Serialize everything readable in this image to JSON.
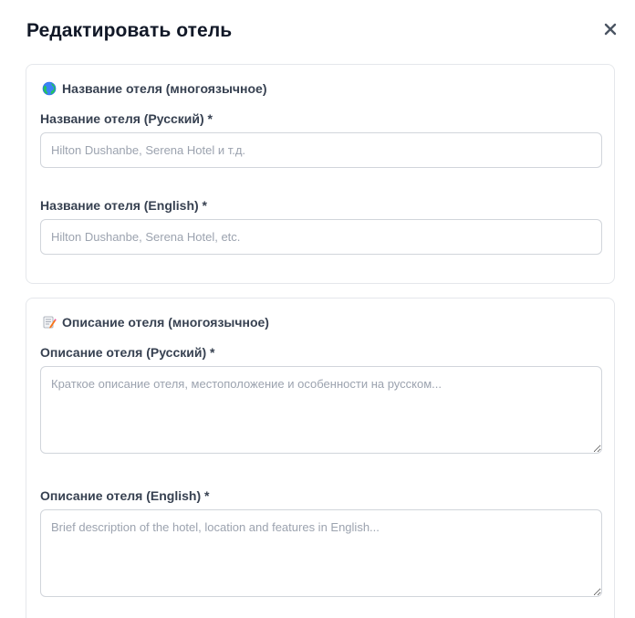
{
  "modal": {
    "title": "Редактировать отель",
    "close_icon": "close-icon"
  },
  "name_section": {
    "icon": "globe-icon",
    "title": "Название отеля (многоязычное)",
    "fields": [
      {
        "label": "Название отеля (Русский) *",
        "value": "",
        "placeholder": "Hilton Dushanbe, Serena Hotel и т.д."
      },
      {
        "label": "Название отеля (English) *",
        "value": "",
        "placeholder": "Hilton Dushanbe, Serena Hotel, etc."
      }
    ]
  },
  "description_section": {
    "icon": "memo-icon",
    "title": "Описание отеля (многоязычное)",
    "fields": [
      {
        "label": "Описание отеля (Русский) *",
        "value": "",
        "placeholder": "Краткое описание отеля, местоположение и особенности на русском..."
      },
      {
        "label": "Описание отеля (English) *",
        "value": "",
        "placeholder": "Brief description of the hotel, location and features in English..."
      }
    ]
  }
}
